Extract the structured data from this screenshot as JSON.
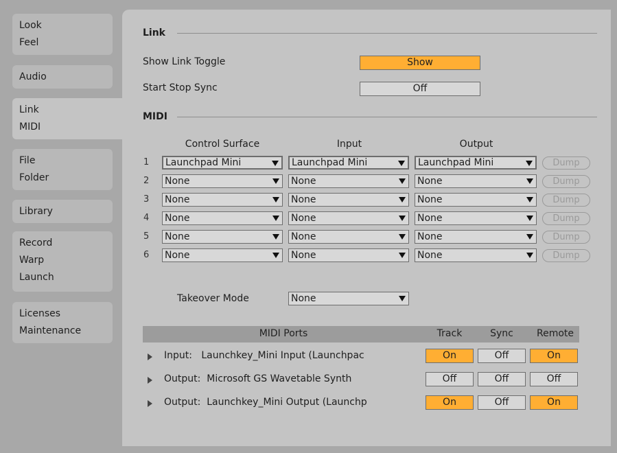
{
  "sidebar": {
    "tabs": [
      {
        "lines": [
          "Look",
          "Feel"
        ]
      },
      {
        "lines": [
          "Audio"
        ]
      },
      {
        "lines": [
          "Link",
          "MIDI"
        ],
        "active": true
      },
      {
        "lines": [
          "File",
          "Folder"
        ]
      },
      {
        "lines": [
          "Library"
        ]
      },
      {
        "lines": [
          "Record",
          "Warp",
          "Launch"
        ]
      },
      {
        "lines": [
          "Licenses",
          "Maintenance"
        ]
      }
    ]
  },
  "link": {
    "heading": "Link",
    "show_link_toggle": {
      "label": "Show Link Toggle",
      "value": "Show"
    },
    "start_stop_sync": {
      "label": "Start Stop Sync",
      "value": "Off"
    }
  },
  "midi": {
    "heading": "MIDI",
    "columns": {
      "control_surface": "Control Surface",
      "input": "Input",
      "output": "Output"
    },
    "dump_label": "Dump",
    "rows": [
      {
        "num": "1",
        "surface": "Launchpad Mini",
        "input": "Launchpad Mini",
        "output": "Launchpad Mini"
      },
      {
        "num": "2",
        "surface": "None",
        "input": "None",
        "output": "None"
      },
      {
        "num": "3",
        "surface": "None",
        "input": "None",
        "output": "None"
      },
      {
        "num": "4",
        "surface": "None",
        "input": "None",
        "output": "None"
      },
      {
        "num": "5",
        "surface": "None",
        "input": "None",
        "output": "None"
      },
      {
        "num": "6",
        "surface": "None",
        "input": "None",
        "output": "None"
      }
    ],
    "takeover": {
      "label": "Takeover Mode",
      "value": "None"
    }
  },
  "ports": {
    "header": {
      "ports": "MIDI Ports",
      "track": "Track",
      "sync": "Sync",
      "remote": "Remote"
    },
    "rows": [
      {
        "label": "Input:   Launchkey_Mini Input (Launchpac",
        "track": "On",
        "sync": "Off",
        "remote": "On"
      },
      {
        "label": "Output:  Microsoft GS Wavetable Synth",
        "track": "Off",
        "sync": "Off",
        "remote": "Off"
      },
      {
        "label": "Output:  Launchkey_Mini Output (Launchp",
        "track": "On",
        "sync": "Off",
        "remote": "On"
      }
    ]
  },
  "colors": {
    "on": "#ffae33",
    "off": "#d7d7d7",
    "panel": "#c4c4c4",
    "background": "#a8a8a8"
  }
}
